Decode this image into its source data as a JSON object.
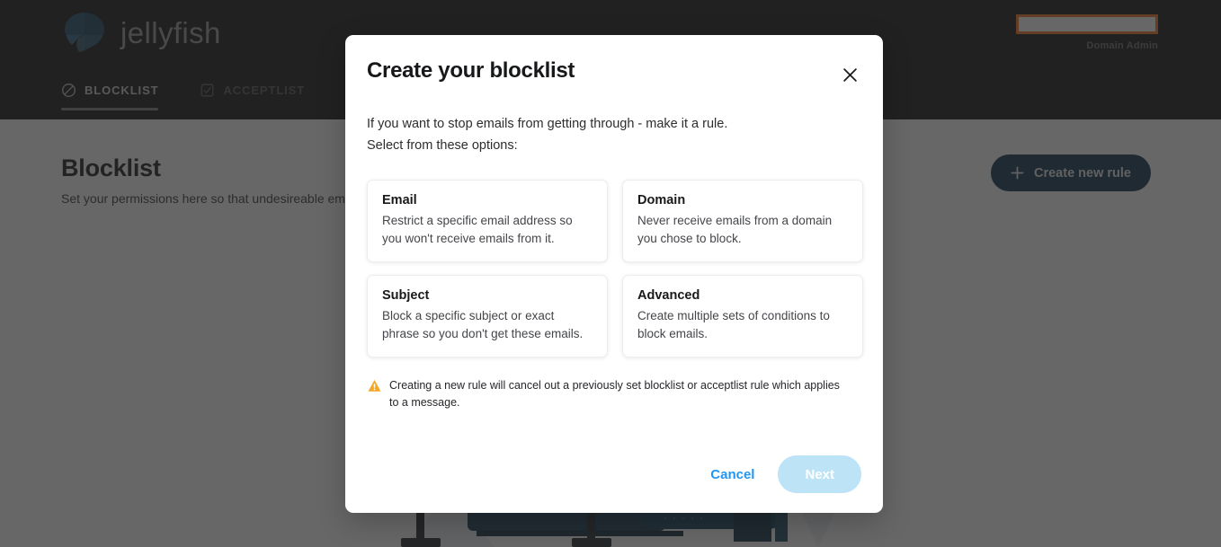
{
  "brand": {
    "name": "jellyfish",
    "logo_icon": "jellyfish-logo-icon"
  },
  "topnav": {
    "tabs": [
      {
        "label": "BLOCKLIST",
        "icon": "no-entry-icon",
        "active": true
      },
      {
        "label": "ACCEPTLIST",
        "icon": "checkbox-checked-icon",
        "active": false
      }
    ],
    "user": {
      "name_redacted": "",
      "role": "Domain Admin",
      "redaction_border_color": "#f0731e"
    }
  },
  "page": {
    "title": "Blocklist",
    "subtitle": "Set your permissions here so that undesireable ema",
    "create_button": {
      "label": "Create new rule",
      "icon": "plus-icon",
      "color": "#0e3552"
    }
  },
  "modal": {
    "title": "Create your blocklist",
    "close_icon": "close-icon",
    "intro_line1": "If you want to stop emails from getting through - make it a rule.",
    "intro_line2": "Select from these options:",
    "options": [
      {
        "title": "Email",
        "description": "Restrict a specific email address so you won't receive emails from it."
      },
      {
        "title": "Domain",
        "description": "Never receive emails from a domain you chose to block."
      },
      {
        "title": "Subject",
        "description": "Block a specific subject or exact phrase so you don't get these emails."
      },
      {
        "title": "Advanced",
        "description": "Create multiple sets of conditions to block emails."
      }
    ],
    "warning": {
      "icon": "warning-triangle-icon",
      "icon_color": "#f5a623",
      "text": "Creating a new rule will cancel out a previously set blocklist or acceptlist rule which applies to a message."
    },
    "footer": {
      "cancel_label": "Cancel",
      "cancel_color": "#2196f3",
      "next_label": "Next",
      "next_color": "#bde3f7",
      "next_disabled": true
    }
  },
  "colors": {
    "topbar_bg": "#141516",
    "overlay": "rgba(38,38,38,0.70)",
    "accent_orange": "#f0731e",
    "accent_blue": "#2196f3"
  }
}
